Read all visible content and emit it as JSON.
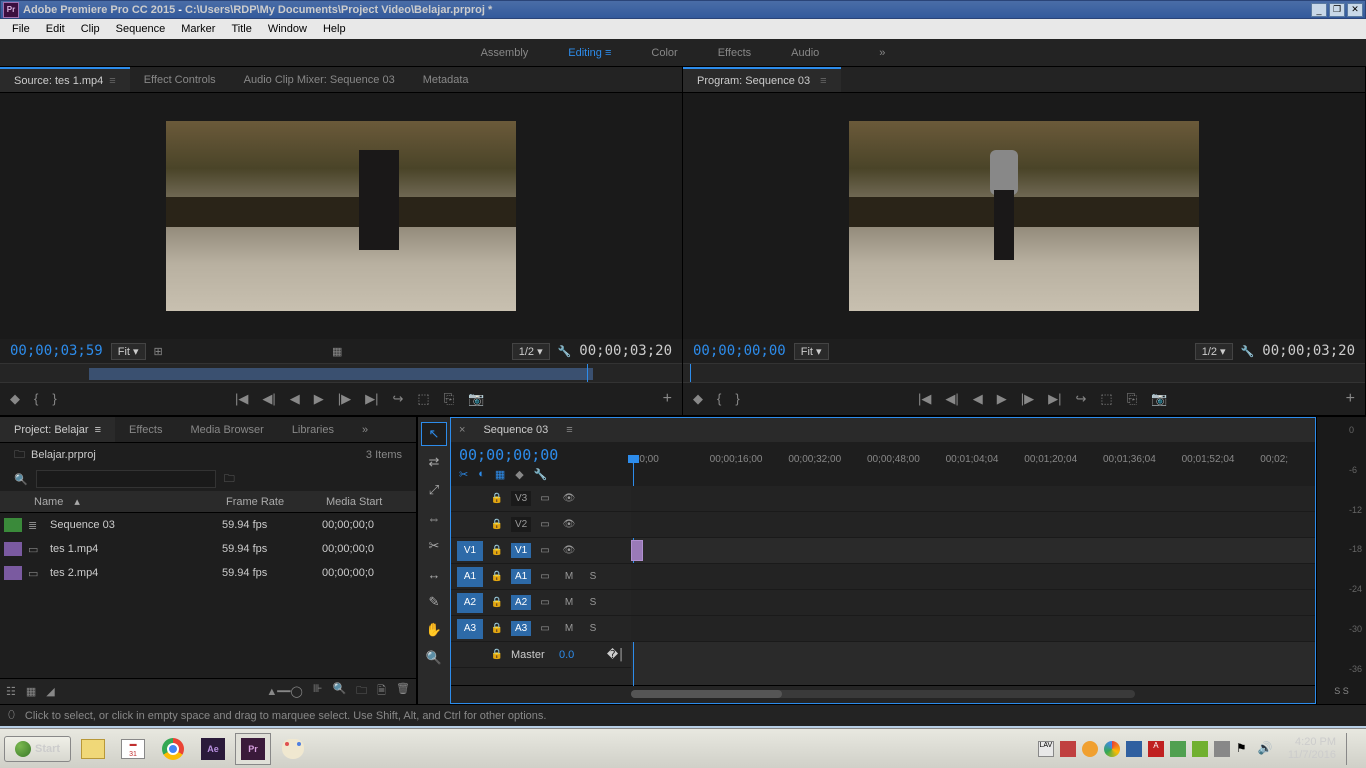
{
  "titlebar": {
    "app": "Adobe Premiere Pro CC 2015",
    "path": "C:\\Users\\RDP\\My Documents\\Project Video\\Belajar.prproj *",
    "icon": "Pr"
  },
  "menubar": [
    "File",
    "Edit",
    "Clip",
    "Sequence",
    "Marker",
    "Title",
    "Window",
    "Help"
  ],
  "workspaces": {
    "items": [
      "Assembly",
      "Editing",
      "Color",
      "Effects",
      "Audio"
    ],
    "active": 1
  },
  "source": {
    "tabs": [
      "Source: tes 1.mp4",
      "Effect Controls",
      "Audio Clip Mixer: Sequence 03",
      "Metadata"
    ],
    "active": 0,
    "tc_left": "00;00;03;59",
    "fit": "Fit",
    "res": "1/2",
    "tc_right": "00;00;03;20"
  },
  "program": {
    "title": "Program: Sequence 03",
    "tc_left": "00;00;00;00",
    "fit": "Fit",
    "res": "1/2",
    "tc_right": "00;00;03;20"
  },
  "transport_icons": [
    "◆",
    "{",
    "}",
    "|◀",
    "◀|",
    "◀",
    "▶",
    "|▶",
    "▶|",
    "↪",
    "⬚",
    "⎘",
    "📷"
  ],
  "project": {
    "tabs": [
      "Project: Belajar",
      "Effects",
      "Media Browser",
      "Libraries"
    ],
    "active": 0,
    "file": "Belajar.prproj",
    "count": "3 Items",
    "headers": {
      "name": "Name",
      "fr": "Frame Rate",
      "ms": "Media Start"
    },
    "items": [
      {
        "label": "green",
        "icon": "≣",
        "name": "Sequence 03",
        "fr": "59.94 fps",
        "ms": "00;00;00;0"
      },
      {
        "label": "purple",
        "icon": "▭",
        "name": "tes 1.mp4",
        "fr": "59.94 fps",
        "ms": "00;00;00;0"
      },
      {
        "label": "purple",
        "icon": "▭",
        "name": "tes 2.mp4",
        "fr": "59.94 fps",
        "ms": "00;00;00;0"
      }
    ]
  },
  "tools": [
    "↖",
    "⇄",
    "⤢",
    "⇔",
    "✂",
    "↔",
    "✎",
    "✋",
    "🔍"
  ],
  "timeline": {
    "tab": "Sequence 03",
    "tc": "00;00;00;00",
    "header_tools": [
      "✂",
      "◐",
      "▦"
    ],
    "header_tools_gray": [
      "◆",
      "🔧"
    ],
    "ticks": [
      ";00;00",
      "00;00;16;00",
      "00;00;32;00",
      "00;00;48;00",
      "00;01;04;04",
      "00;01;20;04",
      "00;01;36;04",
      "00;01;52;04",
      "00;02;"
    ],
    "tracks": {
      "video": [
        {
          "name": "V3"
        },
        {
          "name": "V2"
        },
        {
          "name": "V1",
          "src": "V1",
          "on": true
        }
      ],
      "audio": [
        {
          "name": "A1",
          "src": "A1",
          "on": true
        },
        {
          "name": "A2",
          "src": "A2",
          "on": true
        },
        {
          "name": "A3",
          "src": "A3",
          "on": true
        }
      ],
      "master": {
        "name": "Master",
        "val": "0.0"
      }
    }
  },
  "meters": {
    "scale": [
      "0",
      "-6",
      "-12",
      "-18",
      "-24",
      "-30",
      "-36"
    ],
    "ss": "S  S"
  },
  "status": {
    "hint": "Click to select, or click in empty space and drag to marquee select. Use Shift, Alt, and Ctrl for other options."
  },
  "taskbar": {
    "start": "Start",
    "clock": {
      "time": "4:20 PM",
      "date": "11/7/2016"
    }
  }
}
